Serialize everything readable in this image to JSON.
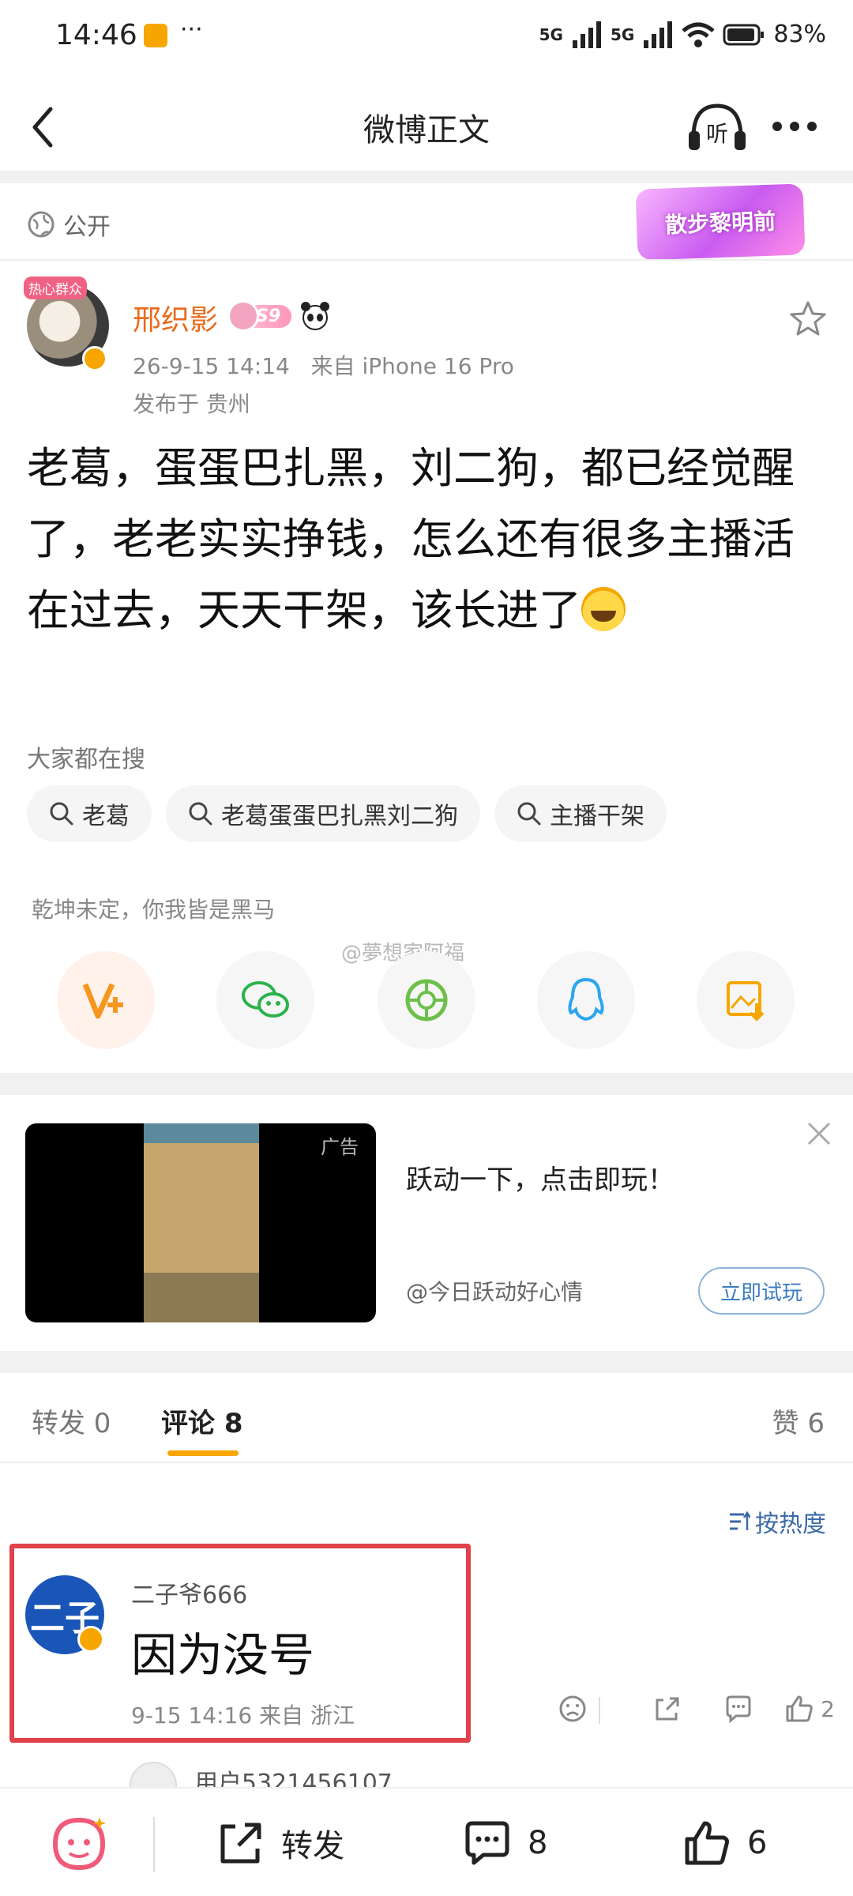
{
  "status_bar": {
    "time": "14:46",
    "battery": "83%",
    "network": [
      "5G",
      "5G"
    ]
  },
  "nav": {
    "title": "微博正文",
    "listen_icon_label": "听"
  },
  "visibility": {
    "label": "公开",
    "sticker_text": "散步黎明前"
  },
  "post": {
    "author": "邢织影",
    "avatar_badge": "热心群众",
    "level": "S9",
    "timestamp": "26-9-15 14:14",
    "source": "来自 iPhone 16 Pro",
    "location": "发布于 贵州",
    "body": "老葛，蛋蛋巴扎黑，刘二狗，都已经觉醒了，老老实实挣钱，怎么还有很多主播活在过去，天天干架，该长进了"
  },
  "hot_search": {
    "title": "大家都在搜",
    "tags": [
      "老葛",
      "老葛蛋蛋巴扎黑刘二狗",
      "主播干架"
    ]
  },
  "share": {
    "caption": "乾坤未定，你我皆是黑马",
    "watermark": "@夢想家阿福",
    "icons": [
      "vplus-icon",
      "wechat-icon",
      "moments-icon",
      "qq-icon",
      "save-image-icon"
    ]
  },
  "ad": {
    "label": "广告",
    "title": "跃动一下，点击即玩！",
    "account": "@今日跃动好心情",
    "cta": "立即试玩"
  },
  "tabs": {
    "repost": "转发 0",
    "comment": "评论 8",
    "like": "赞 6"
  },
  "sort": {
    "label": "按热度"
  },
  "comment": {
    "avatar_text": "二子",
    "name": "二子爷666",
    "text": "因为没号",
    "meta": "9-15 14:16 来自 浙江",
    "likes": "2"
  },
  "reply_preview": {
    "name": "用户5321456107"
  },
  "bottom_bar": {
    "repost_label": "转发",
    "comment_count": "8",
    "like_count": "6"
  },
  "colors": {
    "accent": "#f7a600",
    "author_name": "#e86b1c",
    "link_blue": "#3b6aa6",
    "highlight": "#e0414a"
  }
}
